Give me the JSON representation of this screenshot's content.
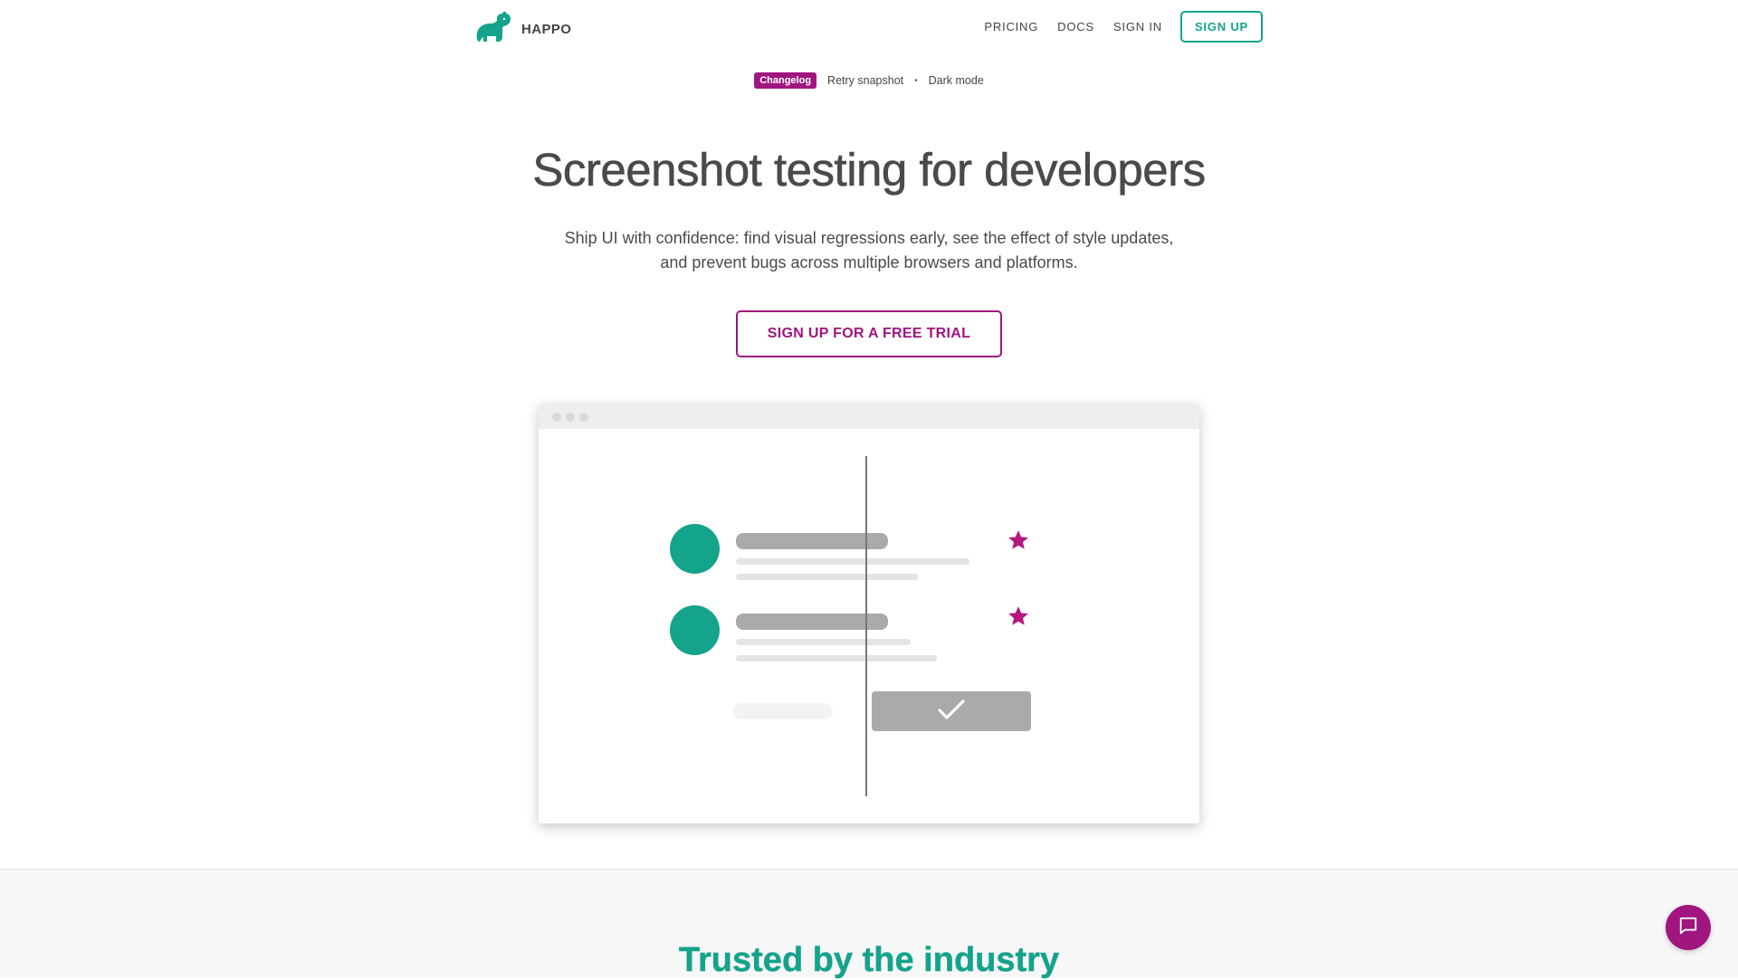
{
  "brand": {
    "name": "HAPPO",
    "logo_icon": "hippo-logo-icon",
    "color": "#14a38b"
  },
  "nav": {
    "links": [
      "PRICING",
      "DOCS",
      "SIGN IN"
    ],
    "signup_label": "SIGN UP"
  },
  "changelog": {
    "badge": "Changelog",
    "items": [
      "Retry snapshot",
      "Dark mode"
    ],
    "separator": "•",
    "badge_color": "#a0157e"
  },
  "hero": {
    "title": "Screenshot testing for developers",
    "subtitle_line1": "Ship UI with confidence: find visual regressions early, see the effect of style updates,",
    "subtitle_line2": "and prevent bugs across multiple browsers and platforms.",
    "cta_label": "SIGN UP FOR A FREE TRIAL",
    "cta_color": "#a0157e"
  },
  "illustration": {
    "list_items": [
      {
        "avatar_color": "#14a38b",
        "starred": true
      },
      {
        "avatar_color": "#14a38b",
        "starred": true
      }
    ],
    "star_color": "#b5167f",
    "confirm_icon": "checkmark-icon"
  },
  "section2": {
    "title": "Trusted by the industry"
  },
  "chat": {
    "icon": "chat-icon"
  }
}
